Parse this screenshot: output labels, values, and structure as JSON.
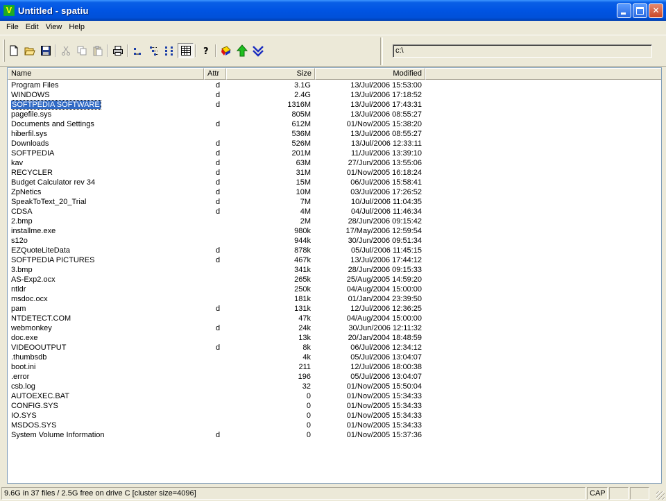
{
  "window": {
    "title": "Untitled - spatiu",
    "app_icon_letter": "V"
  },
  "menu": [
    "File",
    "Edit",
    "View",
    "Help"
  ],
  "toolbar": {
    "buttons": [
      {
        "name": "new-icon",
        "glyph": "🗋"
      },
      {
        "name": "open-icon",
        "glyph": "📂"
      },
      {
        "name": "save-icon",
        "glyph": "💾"
      },
      {
        "name": "cut-icon",
        "glyph": "✂"
      },
      {
        "name": "copy-icon",
        "glyph": "⧉"
      },
      {
        "name": "paste-icon",
        "glyph": "📋"
      },
      {
        "name": "print-icon",
        "glyph": "🖶"
      },
      {
        "name": "small-icons-view-icon",
        "glyph": "▫"
      },
      {
        "name": "list-view-icon",
        "glyph": "⋮"
      },
      {
        "name": "tree-view-icon",
        "glyph": "☷"
      },
      {
        "name": "details-view-icon",
        "glyph": "▦"
      },
      {
        "name": "help-icon",
        "glyph": "?"
      },
      {
        "name": "color-icon",
        "glyph": "■"
      },
      {
        "name": "up-arrow-icon",
        "glyph": "↑"
      },
      {
        "name": "drill-down-icon",
        "glyph": "⇊"
      }
    ]
  },
  "path": {
    "value": "c:\\"
  },
  "columns": {
    "name": "Name",
    "attr": "Attr",
    "size": "Size",
    "modified": "Modified"
  },
  "files": [
    {
      "name": "Program Files",
      "attr": "d",
      "size": "3.1G",
      "modified": "13/Jul/2006 15:53:00"
    },
    {
      "name": "WINDOWS",
      "attr": "d",
      "size": "2.4G",
      "modified": "13/Jul/2006 17:18:52"
    },
    {
      "name": "SOFTPEDIA SOFTWARE",
      "attr": "d",
      "size": "1316M",
      "modified": "13/Jul/2006 17:43:31",
      "selected": true
    },
    {
      "name": "pagefile.sys",
      "attr": "",
      "size": "805M",
      "modified": "13/Jul/2006 08:55:27"
    },
    {
      "name": "Documents and Settings",
      "attr": "d",
      "size": "612M",
      "modified": "01/Nov/2005 15:38:20"
    },
    {
      "name": "hiberfil.sys",
      "attr": "",
      "size": "536M",
      "modified": "13/Jul/2006 08:55:27"
    },
    {
      "name": "Downloads",
      "attr": "d",
      "size": "526M",
      "modified": "13/Jul/2006 12:33:11"
    },
    {
      "name": "SOFTPEDIA",
      "attr": "d",
      "size": "201M",
      "modified": "11/Jul/2006 13:39:10"
    },
    {
      "name": "kav",
      "attr": "d",
      "size": "63M",
      "modified": "27/Jun/2006 13:55:06"
    },
    {
      "name": "RECYCLER",
      "attr": "d",
      "size": "31M",
      "modified": "01/Nov/2005 16:18:24"
    },
    {
      "name": "Budget Calculator rev 34",
      "attr": "d",
      "size": "15M",
      "modified": "06/Jul/2006 15:58:41"
    },
    {
      "name": "ZpNetics",
      "attr": "d",
      "size": "10M",
      "modified": "03/Jul/2006 17:26:52"
    },
    {
      "name": "SpeakToText_20_Trial",
      "attr": "d",
      "size": "7M",
      "modified": "10/Jul/2006 11:04:35"
    },
    {
      "name": "CDSA",
      "attr": "d",
      "size": "4M",
      "modified": "04/Jul/2006 11:46:34"
    },
    {
      "name": "2.bmp",
      "attr": "",
      "size": "2M",
      "modified": "28/Jun/2006 09:15:42"
    },
    {
      "name": "installme.exe",
      "attr": "",
      "size": "980k",
      "modified": "17/May/2006 12:59:54"
    },
    {
      "name": "s12o",
      "attr": "",
      "size": "944k",
      "modified": "30/Jun/2006 09:51:34"
    },
    {
      "name": "EZQuoteLiteData",
      "attr": "d",
      "size": "878k",
      "modified": "05/Jul/2006 11:45:15"
    },
    {
      "name": "SOFTPEDIA PICTURES",
      "attr": "d",
      "size": "467k",
      "modified": "13/Jul/2006 17:44:12"
    },
    {
      "name": "3.bmp",
      "attr": "",
      "size": "341k",
      "modified": "28/Jun/2006 09:15:33"
    },
    {
      "name": "AS-Exp2.ocx",
      "attr": "",
      "size": "265k",
      "modified": "25/Aug/2005 14:59:20"
    },
    {
      "name": "ntldr",
      "attr": "",
      "size": "250k",
      "modified": "04/Aug/2004 15:00:00"
    },
    {
      "name": "msdoc.ocx",
      "attr": "",
      "size": "181k",
      "modified": "01/Jan/2004 23:39:50"
    },
    {
      "name": "pam",
      "attr": "d",
      "size": "131k",
      "modified": "12/Jul/2006 12:36:25"
    },
    {
      "name": "NTDETECT.COM",
      "attr": "",
      "size": "47k",
      "modified": "04/Aug/2004 15:00:00"
    },
    {
      "name": "webmonkey",
      "attr": "d",
      "size": "24k",
      "modified": "30/Jun/2006 12:11:32"
    },
    {
      "name": "doc.exe",
      "attr": "",
      "size": "13k",
      "modified": "20/Jan/2004 18:48:59"
    },
    {
      "name": "VIDEOOUTPUT",
      "attr": "d",
      "size": "8k",
      "modified": "06/Jul/2006 12:34:12"
    },
    {
      "name": ".thumbsdb",
      "attr": "",
      "size": "4k",
      "modified": "05/Jul/2006 13:04:07"
    },
    {
      "name": "boot.ini",
      "attr": "",
      "size": "211",
      "modified": "12/Jul/2006 18:00:38"
    },
    {
      "name": ".error",
      "attr": "",
      "size": "196",
      "modified": "05/Jul/2006 13:04:07"
    },
    {
      "name": "csb.log",
      "attr": "",
      "size": "32",
      "modified": "01/Nov/2005 15:50:04"
    },
    {
      "name": "AUTOEXEC.BAT",
      "attr": "",
      "size": "0",
      "modified": "01/Nov/2005 15:34:33"
    },
    {
      "name": "CONFIG.SYS",
      "attr": "",
      "size": "0",
      "modified": "01/Nov/2005 15:34:33"
    },
    {
      "name": "IO.SYS",
      "attr": "",
      "size": "0",
      "modified": "01/Nov/2005 15:34:33"
    },
    {
      "name": "MSDOS.SYS",
      "attr": "",
      "size": "0",
      "modified": "01/Nov/2005 15:34:33"
    },
    {
      "name": "System Volume Information",
      "attr": "d",
      "size": "0",
      "modified": "01/Nov/2005 15:37:36"
    }
  ],
  "status": {
    "summary": "9.6G in 37 files / 2.5G free on drive C  [cluster size=4096]",
    "cap": "CAP",
    "num": "",
    "scrl": ""
  },
  "colors": {
    "titlebar": "#0054e3",
    "selection": "#316ac5",
    "face": "#ece9d8"
  }
}
